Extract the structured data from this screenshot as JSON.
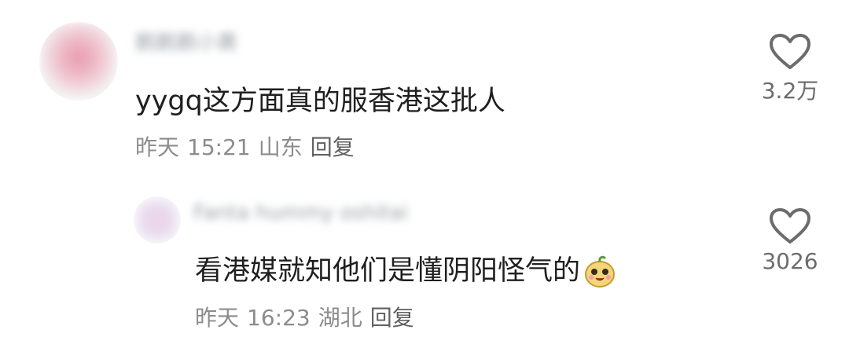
{
  "comments": [
    {
      "username": "鹅鹅鹅小黄",
      "text": "yygq这方面真的服香港这批人",
      "date": "昨天",
      "time": "15:21",
      "location": "山东",
      "reply_label": "回复",
      "like_count": "3.2万",
      "avatar_color": "#e79aad"
    },
    {
      "username": "Fanta hummy oshitai",
      "text": "看港媒就知他们是懂阴阳怪气的",
      "emoji": "doge-bean-emoji",
      "date": "昨天",
      "time": "16:23",
      "location": "湖北",
      "reply_label": "回复",
      "like_count": "3026",
      "avatar_color": "#e7d6ee"
    }
  ],
  "colors": {
    "text": "#1f1f1f",
    "meta": "#8c8c8c",
    "icon": "#6c6c6c"
  }
}
